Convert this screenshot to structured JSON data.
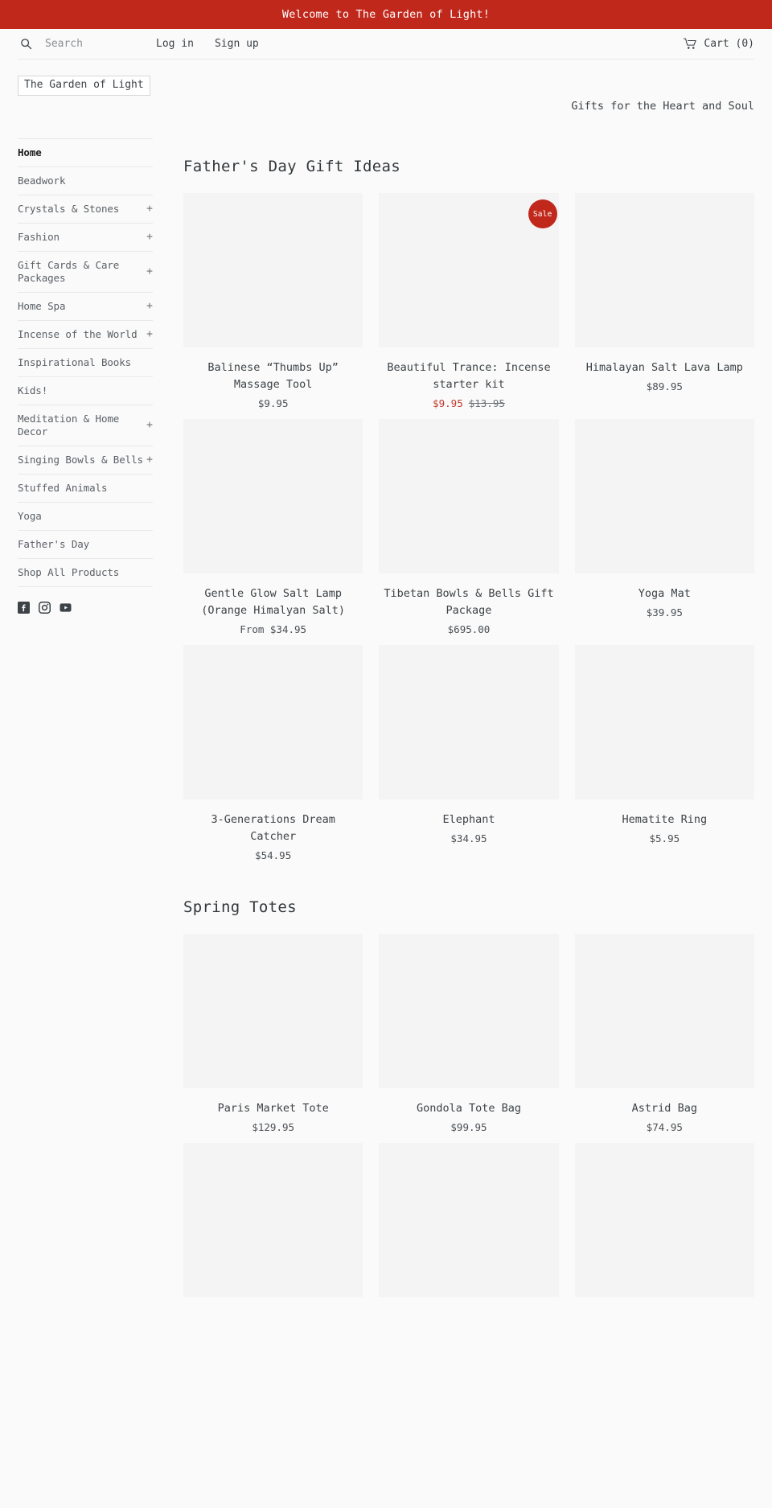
{
  "announcement": {
    "text": "Welcome to The Garden of Light!",
    "background": "#c0281c",
    "color": "#ffffff"
  },
  "topbar": {
    "search_placeholder": "Search",
    "search_value": "",
    "login_label": "Log in",
    "signup_label": "Sign up",
    "cart_label": "Cart (0)"
  },
  "brand": {
    "logo_text": "The Garden of Light",
    "tagline": "Gifts for the Heart and Soul"
  },
  "sidebar": {
    "items": [
      {
        "label": "Home",
        "expandable": "",
        "active": true
      },
      {
        "label": "Beadwork",
        "expandable": "",
        "active": false
      },
      {
        "label": "Crystals & Stones",
        "expandable": "+",
        "active": false
      },
      {
        "label": "Fashion",
        "expandable": "+",
        "active": false
      },
      {
        "label": "Gift Cards & Care Packages",
        "expandable": "+",
        "active": false
      },
      {
        "label": "Home Spa",
        "expandable": "+",
        "active": false
      },
      {
        "label": "Incense of the World",
        "expandable": "+",
        "active": false
      },
      {
        "label": "Inspirational Books",
        "expandable": "",
        "active": false
      },
      {
        "label": "Kids!",
        "expandable": "",
        "active": false
      },
      {
        "label": "Meditation & Home Decor",
        "expandable": "+",
        "active": false
      },
      {
        "label": "Singing Bowls & Bells",
        "expandable": "+",
        "active": false
      },
      {
        "label": "Stuffed Animals",
        "expandable": "",
        "active": false
      },
      {
        "label": "Yoga",
        "expandable": "",
        "active": false
      },
      {
        "label": "Father's Day",
        "expandable": "",
        "active": false
      },
      {
        "label": "Shop All Products",
        "expandable": "",
        "active": false
      }
    ],
    "social": [
      {
        "icon": "facebook-icon"
      },
      {
        "icon": "instagram-icon"
      },
      {
        "icon": "youtube-icon"
      }
    ]
  },
  "sections": [
    {
      "title": "Father's Day Gift Ideas",
      "products": [
        {
          "title": "Balinese “Thumbs Up” Massage Tool",
          "price": "$9.95",
          "compare_at": "",
          "badge": ""
        },
        {
          "title": "Beautiful Trance: Incense starter kit",
          "price": "$9.95",
          "compare_at": "$13.95",
          "badge": "Sale"
        },
        {
          "title": "Himalayan Salt Lava Lamp",
          "price": "$89.95",
          "compare_at": "",
          "badge": ""
        },
        {
          "title": "Gentle Glow Salt Lamp (Orange Himalyan Salt)",
          "price": "From $34.95",
          "compare_at": "",
          "badge": ""
        },
        {
          "title": "Tibetan Bowls & Bells Gift Package",
          "price": "$695.00",
          "compare_at": "",
          "badge": ""
        },
        {
          "title": "Yoga Mat",
          "price": "$39.95",
          "compare_at": "",
          "badge": ""
        },
        {
          "title": "3-Generations Dream Catcher",
          "price": "$54.95",
          "compare_at": "",
          "badge": ""
        },
        {
          "title": "Elephant",
          "price": "$34.95",
          "compare_at": "",
          "badge": ""
        },
        {
          "title": "Hematite Ring",
          "price": "$5.95",
          "compare_at": "",
          "badge": ""
        }
      ]
    },
    {
      "title": "Spring Totes",
      "products": [
        {
          "title": "Paris Market Tote",
          "price": "$129.95",
          "compare_at": "",
          "badge": ""
        },
        {
          "title": "Gondola Tote Bag",
          "price": "$99.95",
          "compare_at": "",
          "badge": ""
        },
        {
          "title": "Astrid Bag",
          "price": "$74.95",
          "compare_at": "",
          "badge": ""
        },
        {
          "title": "",
          "price": "",
          "compare_at": "",
          "badge": ""
        },
        {
          "title": "",
          "price": "",
          "compare_at": "",
          "badge": ""
        },
        {
          "title": "",
          "price": "",
          "compare_at": "",
          "badge": ""
        }
      ]
    }
  ]
}
